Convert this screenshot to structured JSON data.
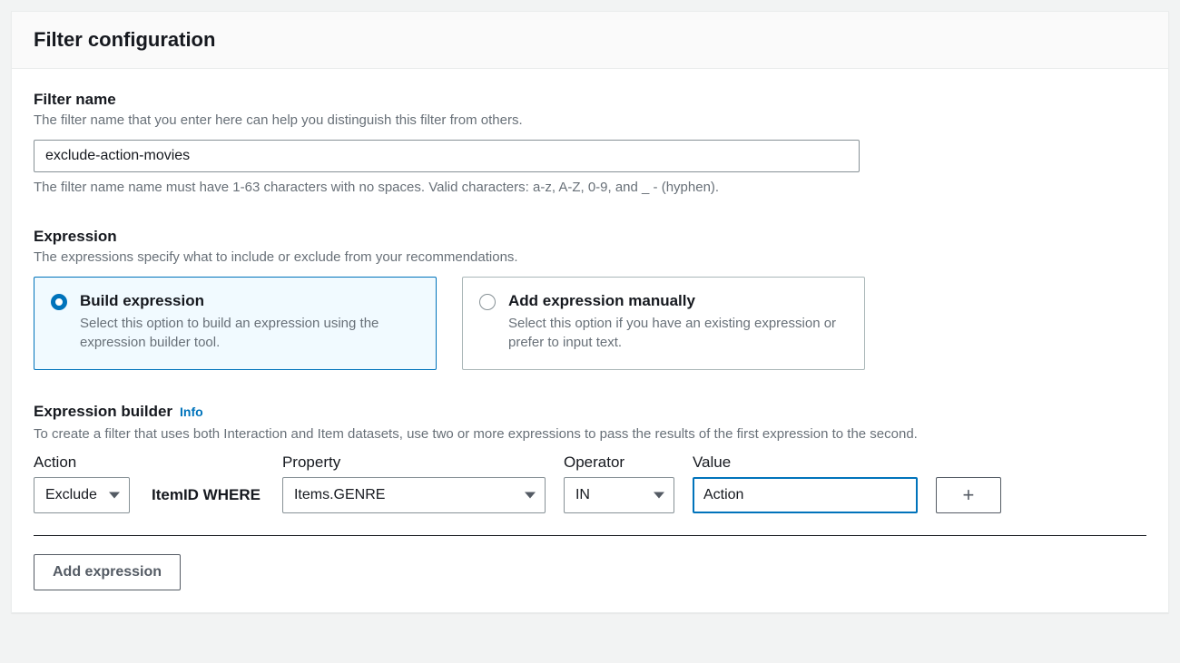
{
  "panel": {
    "title": "Filter configuration"
  },
  "filterName": {
    "label": "Filter name",
    "hint": "The filter name that you enter here can help you distinguish this filter from others.",
    "value": "exclude-action-movies",
    "constraint": "The filter name name must have 1-63 characters with no spaces. Valid characters: a-z, A-Z, 0-9, and _ - (hyphen)."
  },
  "expression": {
    "label": "Expression",
    "hint": "The expressions specify what to include or exclude from your recommendations.",
    "options": {
      "build": {
        "title": "Build expression",
        "desc": "Select this option to build an expression using the expression builder tool."
      },
      "manual": {
        "title": "Add expression manually",
        "desc": "Select this option if you have an existing expression or prefer to input text."
      }
    }
  },
  "builder": {
    "title": "Expression builder",
    "info": "Info",
    "hint": "To create a filter that uses both Interaction and Item datasets, use two or more expressions to pass the results of the first expression to the second.",
    "columns": {
      "action": "Action",
      "property": "Property",
      "operator": "Operator",
      "value": "Value"
    },
    "row": {
      "action": "Exclude",
      "whereLabel": "ItemID WHERE",
      "property": "Items.GENRE",
      "operator": "IN",
      "value": "Action"
    },
    "addButton": "Add expression"
  }
}
